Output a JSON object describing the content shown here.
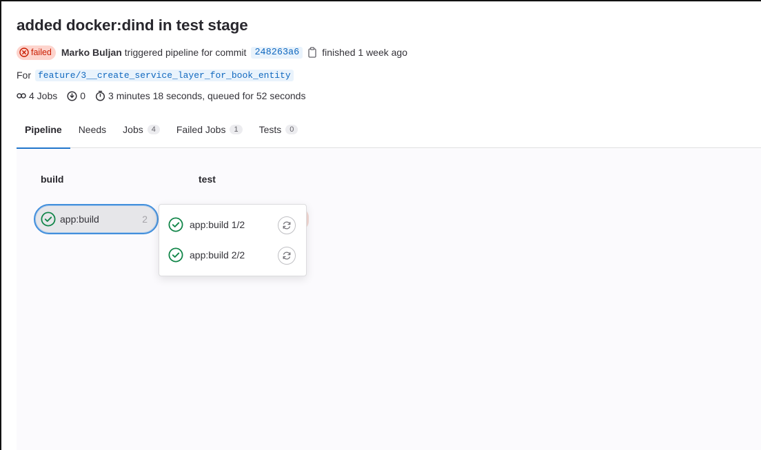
{
  "pipeline": {
    "title": "added docker:dind in test stage",
    "status_label": "failed",
    "author": "Marko Buljan",
    "action_text": "triggered pipeline for commit",
    "commit_sha": "248263a6",
    "finished_text": "finished 1 week ago",
    "for_label": "For",
    "branch": "feature/3__create_service_layer_for_book_entity",
    "jobs_text": "4 Jobs",
    "retried_count": "0",
    "duration_text": "3 minutes 18 seconds, queued for 52 seconds"
  },
  "tabs": [
    {
      "label": "Pipeline",
      "count": null
    },
    {
      "label": "Needs",
      "count": null
    },
    {
      "label": "Jobs",
      "count": "4"
    },
    {
      "label": "Failed Jobs",
      "count": "1"
    },
    {
      "label": "Tests",
      "count": "0"
    }
  ],
  "stages": [
    {
      "name": "build"
    },
    {
      "name": "test"
    }
  ],
  "job_group": {
    "name": "app:build",
    "count": "2"
  },
  "dropdown_jobs": [
    {
      "name": "app:build 1/2"
    },
    {
      "name": "app:build 2/2"
    }
  ],
  "icons": {
    "status_failed": "status-failed-icon",
    "copy": "clipboard-icon",
    "jobs": "pipeline-jobs-icon",
    "retried": "retried-icon",
    "timer": "timer-icon",
    "success": "status-success-icon",
    "retry": "retry-icon"
  },
  "colors": {
    "failed_bg": "#fdd4cd",
    "failed_text": "#c91c00",
    "success": "#108548",
    "link": "#1068bf",
    "tab_active": "#1f75cb"
  }
}
